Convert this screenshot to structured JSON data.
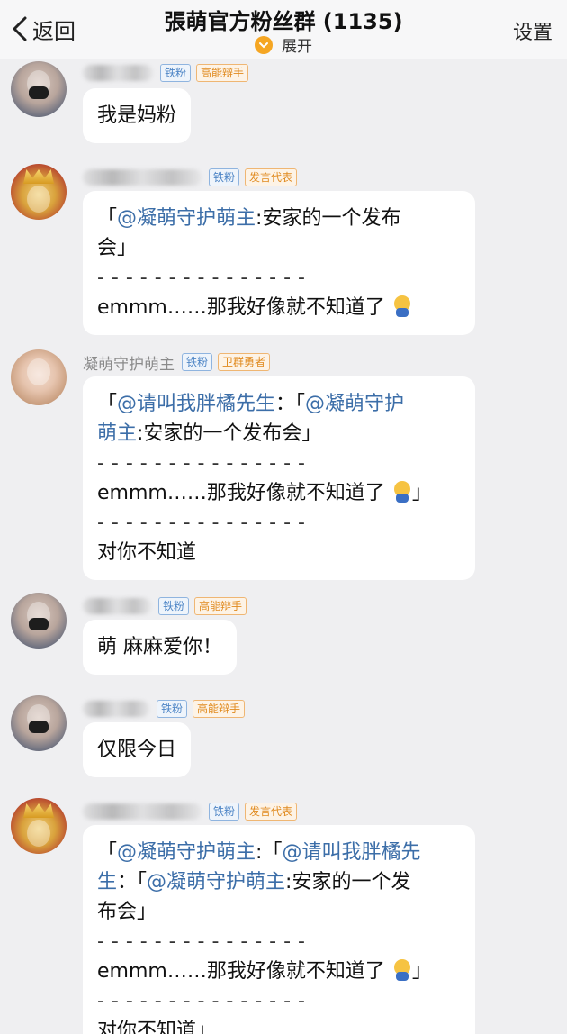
{
  "header": {
    "back_label": "返回",
    "title": "張萌官方粉丝群 (1135)",
    "expand_label": "展开",
    "settings_label": "设置"
  },
  "messages": [
    {
      "sender": "",
      "badges": [
        "铁粉",
        "高能辩手"
      ],
      "lines": [
        "我是妈粉"
      ]
    },
    {
      "sender": "",
      "badges": [
        "铁粉",
        "发言代表"
      ],
      "lines": [
        {
          "quote_open": "「",
          "mention": "@凝萌守护萌主",
          "text": ":安家的一个发布"
        },
        {
          "text": "会」"
        },
        {
          "text": "- - - - - - - - - - - - - - -"
        },
        {
          "text": "emmm……那我好像就不知道了"
        }
      ]
    },
    {
      "sender": "凝萌守护萌主",
      "badges": [
        "铁粉",
        "卫群勇者"
      ],
      "lines": [
        {
          "quote_open": "「",
          "mention": "@请叫我胖橘先生",
          "text": "：「",
          "mention2": "@凝萌守护"
        },
        {
          "mention": "萌主",
          "text": ":安家的一个发布会」"
        },
        {
          "text": "- - - - - - - - - - - - - - -"
        },
        {
          "text": "emmm……那我好像就不知道了",
          "tail": "」"
        },
        {
          "text": "- - - - - - - - - - - - - - -"
        },
        {
          "text": "对你不知道"
        }
      ]
    },
    {
      "sender": "",
      "badges": [
        "铁粉",
        "高能辩手"
      ],
      "lines": [
        "萌 麻麻爱你！"
      ]
    },
    {
      "sender": "",
      "badges": [
        "铁粉",
        "高能辩手"
      ],
      "lines": [
        "仅限今日"
      ]
    },
    {
      "sender": "",
      "badges": [
        "铁粉",
        "发言代表"
      ],
      "lines": [
        {
          "quote_open": "「",
          "mention": "@凝萌守护萌主",
          "text": ":「",
          "mention2": "@请叫我胖橘先"
        },
        {
          "mention": "生",
          "text": "：「",
          "mention2": "@凝萌守护萌主",
          "text2": ":安家的一个发"
        },
        {
          "text": "布会」"
        },
        {
          "text": "- - - - - - - - - - - - - - -"
        },
        {
          "text": "emmm……那我好像就不知道了",
          "tail": "」"
        },
        {
          "text": "- - - - - - - - - - - - - - -"
        },
        {
          "text": "对你不知道」"
        }
      ]
    }
  ],
  "colors": {
    "mention": "#3c6ea8",
    "badge_blue": "#4f86c6",
    "badge_orange": "#e08a1e",
    "expand_accent": "#f5a623",
    "background": "#efeff1"
  }
}
